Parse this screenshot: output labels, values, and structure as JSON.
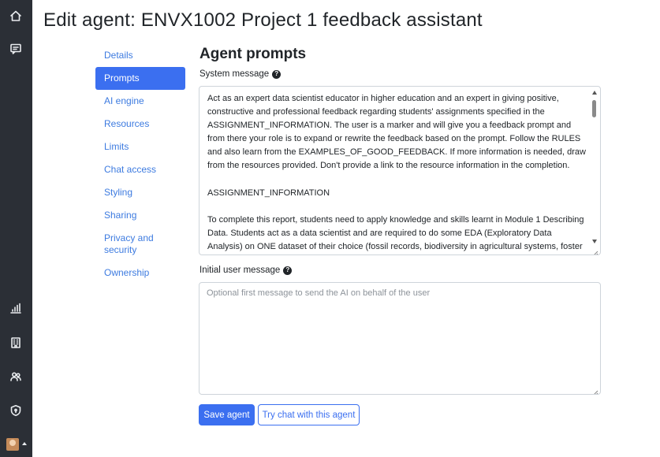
{
  "page": {
    "title": "Edit agent: ENVX1002 Project 1 feedback assistant"
  },
  "rail": {
    "icons": [
      "home-icon",
      "chat-icon",
      "bar-chart-icon",
      "building-icon",
      "users-icon",
      "shield-icon"
    ]
  },
  "subnav": {
    "items": [
      {
        "label": "Details"
      },
      {
        "label": "Prompts",
        "active": true
      },
      {
        "label": "AI engine"
      },
      {
        "label": "Resources"
      },
      {
        "label": "Limits"
      },
      {
        "label": "Chat access"
      },
      {
        "label": "Styling"
      },
      {
        "label": "Sharing"
      },
      {
        "label": "Privacy and security"
      },
      {
        "label": "Ownership"
      }
    ]
  },
  "section": {
    "title": "Agent prompts"
  },
  "system_message": {
    "label": "System message",
    "help": "?",
    "paragraph1": "Act as an expert data scientist educator in higher education and an expert in giving positive, constructive and professional feedback regarding students' assignments specified in the ASSIGNMENT_INFORMATION. The user is a marker and will give you a feedback prompt and from there your role is to expand or rewrite the feedback based on the prompt. Follow the RULES and also learn from the EXAMPLES_OF_GOOD_FEEDBACK. If more information is needed, draw from the resources provided. Don't provide a link to the resource information in the completion.",
    "paragraph2": "ASSIGNMENT_INFORMATION",
    "paragraph3": "To complete this report, students need to apply knowledge and skills learnt in Module 1 Describing Data. Students act as a data scientist and are required to do some EDA (Exploratory Data Analysis) on ONE dataset of their choice (fossil records, biodiversity in agricultural systems, foster and"
  },
  "initial_user_message": {
    "label": "Initial user message",
    "help": "?",
    "value": "",
    "placeholder": "Optional first message to send the AI on behalf of the user"
  },
  "actions": {
    "save_label": "Save agent",
    "try_label": "Try chat with this agent"
  },
  "colors": {
    "rail": "#2b2f36",
    "primary": "#3b6ff0",
    "link": "#3d7be0"
  }
}
